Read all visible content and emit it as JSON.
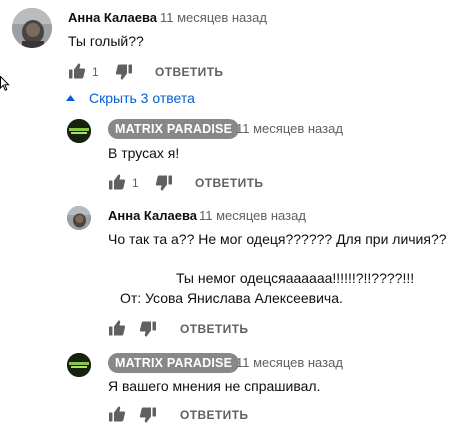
{
  "colors": {
    "link": "#065fd4",
    "meta": "#606060",
    "badge": "#888888"
  },
  "top_comment": {
    "author": "Анна Калаева",
    "time": "11 месяцев назад",
    "text": "Ты голый??",
    "likes": "1",
    "reply_label": "ОТВЕТИТЬ"
  },
  "replies_toggle": {
    "icon": "chevron-up-icon",
    "label": "Скрыть 3 ответа"
  },
  "replies": [
    {
      "author": "MATRIX PARADISE",
      "time": "11 месяцев назад",
      "text": "В трусах я!",
      "likes": "1",
      "reply_label": "ОТВЕТИТЬ"
    },
    {
      "author": "Анна Калаева",
      "time": "11 месяцев назад",
      "text_line1": "Чо так та а?? Не мог одеця?????? Для при личия??",
      "text_line2": "Ты немог одецсяаааааа!!!!!!?!!????!!!",
      "text_line3": "От: Усова Янислава Алексеевича.",
      "reply_label": "ОТВЕТИТЬ"
    },
    {
      "author": "MATRIX PARADISE",
      "time": "11 месяцев назад",
      "text": "Я вашего мнения не спрашивал.",
      "reply_label": "ОТВЕТИТЬ"
    }
  ]
}
